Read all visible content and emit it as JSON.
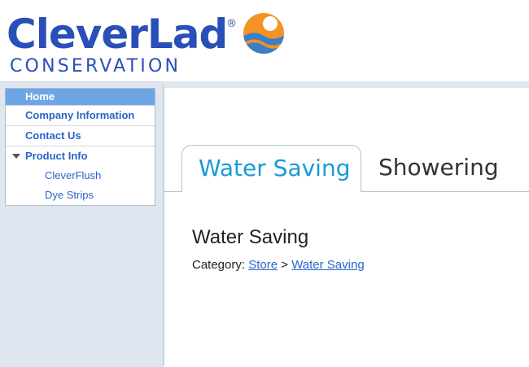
{
  "logo": {
    "main": "CleverLad",
    "registered": "®",
    "sub": "CONSERVATION",
    "colors": {
      "text": "#2a4fb8",
      "sun": "#f39325",
      "wave": "#3a7ec6"
    }
  },
  "sidebar": {
    "items": [
      {
        "label": "Home",
        "active": true
      },
      {
        "label": "Company Information"
      },
      {
        "label": "Contact Us"
      },
      {
        "label": "Product Info",
        "expanded": true
      }
    ],
    "subitems": [
      {
        "label": "CleverFlush"
      },
      {
        "label": "Dye Strips"
      }
    ]
  },
  "tabs": [
    {
      "label": "Water Saving",
      "active": true
    },
    {
      "label": "Showering"
    }
  ],
  "main": {
    "title": "Water Saving",
    "category_label": "Category:",
    "breadcrumb": [
      "Store",
      "Water Saving"
    ],
    "breadcrumb_sep": ">"
  },
  "colors": {
    "accent": "#1a9ad6",
    "link": "#2a64c8",
    "menu_active_bg": "#6ea5e4",
    "sidebar_bg": "#dfe6ef"
  }
}
